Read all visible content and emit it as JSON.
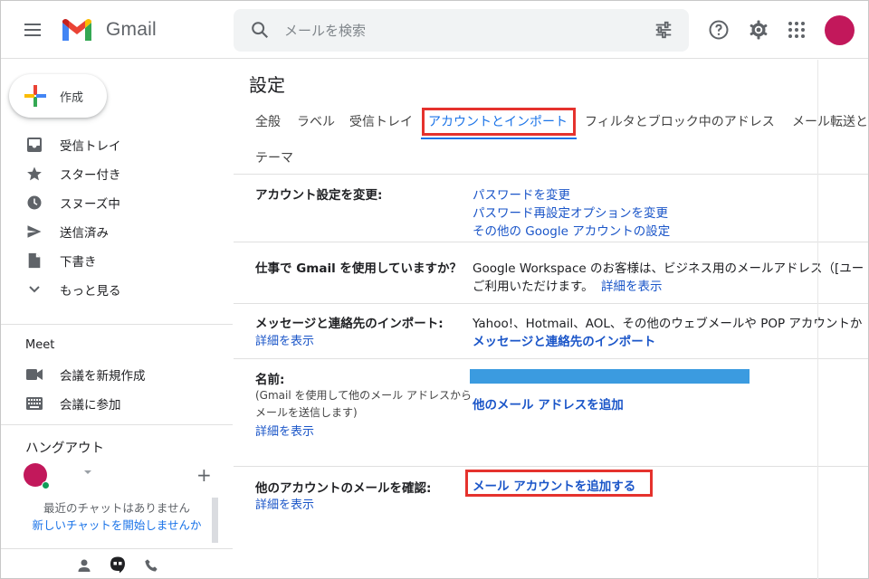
{
  "header": {
    "app_name": "Gmail",
    "search_placeholder": "メールを検索"
  },
  "sidebar": {
    "compose": "作成",
    "nav": [
      {
        "label": "受信トレイ",
        "icon": "inbox-icon"
      },
      {
        "label": "スター付き",
        "icon": "star-icon"
      },
      {
        "label": "スヌーズ中",
        "icon": "clock-icon"
      },
      {
        "label": "送信済み",
        "icon": "send-icon"
      },
      {
        "label": "下書き",
        "icon": "draft-icon"
      },
      {
        "label": "もっと見る",
        "icon": "chevron-down-icon"
      }
    ],
    "meet_title": "Meet",
    "meet": [
      {
        "label": "会議を新規作成",
        "icon": "video-icon"
      },
      {
        "label": "会議に参加",
        "icon": "keyboard-icon"
      }
    ],
    "hangouts_title": "ハングアウト",
    "chat_empty_line1": "最近のチャットはありません",
    "chat_empty_line2": "新しいチャットを開始しませんか"
  },
  "main": {
    "title": "設定",
    "tabs": [
      "全般",
      "ラベル",
      "受信トレイ",
      "アカウントとインポート",
      "フィルタとブロック中のアドレス",
      "メール転送と",
      "テーマ"
    ],
    "active_tab": "アカウントとインポート",
    "rows": {
      "account": {
        "label": "アカウント設定を変更:",
        "links": [
          "パスワードを変更",
          "パスワード再設定オプションを変更",
          "その他の Google アカウントの設定"
        ]
      },
      "workspace": {
        "label": "仕事で Gmail を使用していますか？",
        "text1": "Google Workspace のお客様は、ビジネス用のメールアドレス（[ユー",
        "text2": "ご利用いただけます。",
        "link": "詳細を表示"
      },
      "import": {
        "label": "メッセージと連絡先のインポート:",
        "sub_link": "詳細を表示",
        "text": "Yahoo!、Hotmail、AOL、その他のウェブメールや POP アカウントか",
        "link": "メッセージと連絡先のインポート"
      },
      "name": {
        "label": "名前:",
        "sub1": "(Gmail を使用して他のメール アドレスから",
        "sub2": "メールを送信します)",
        "sub_link": "詳細を表示",
        "link": "他のメール アドレスを追加"
      },
      "check": {
        "label": "他のアカウントのメールを確認:",
        "sub_link": "詳細を表示",
        "link": "メール アカウントを追加する"
      }
    }
  },
  "colors": {
    "accent": "#1a73e8",
    "highlight": "#e5322d",
    "avatar": "#c2185b"
  }
}
